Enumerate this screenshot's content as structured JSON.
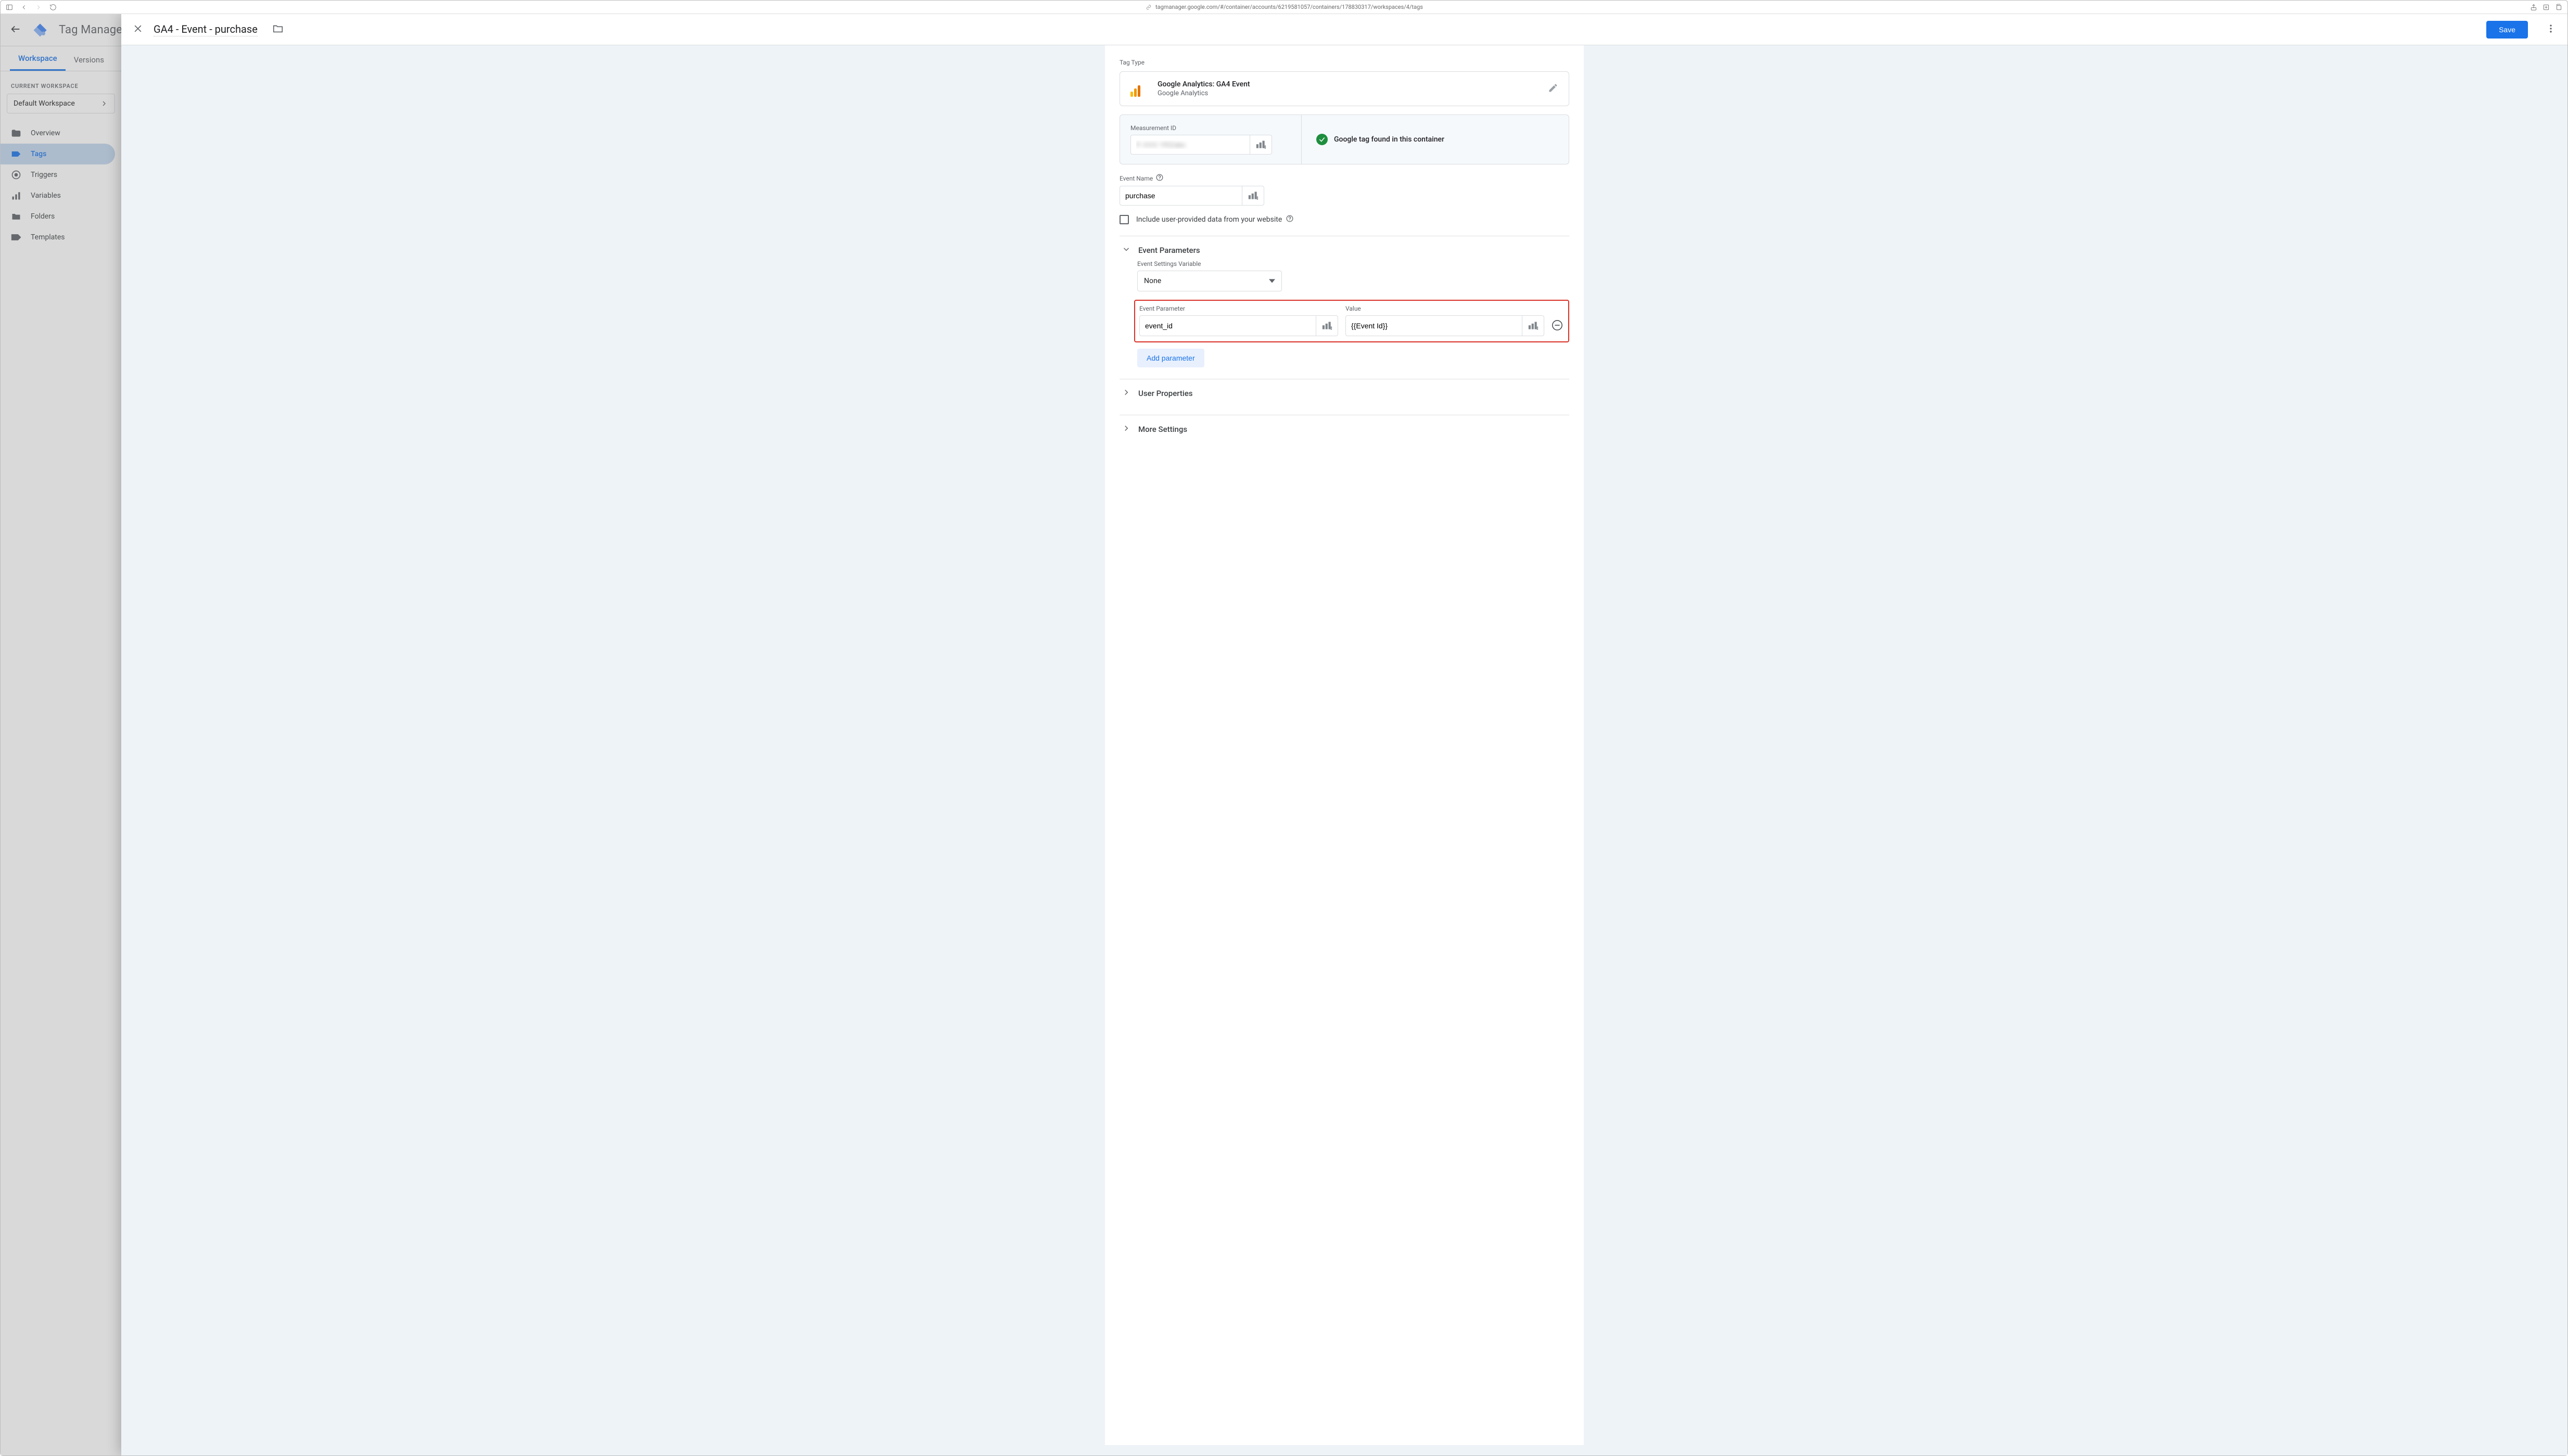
{
  "browser": {
    "url": "tagmanager.google.com/#/container/accounts/6219581057/containers/178830317/workspaces/4/tags"
  },
  "app": {
    "title": "Tag Manager",
    "tabs": {
      "workspace": "Workspace",
      "versions": "Versions"
    },
    "workspace_label": "CURRENT WORKSPACE",
    "workspace_name": "Default Workspace",
    "nav": {
      "overview": "Overview",
      "tags": "Tags",
      "triggers": "Triggers",
      "variables": "Variables",
      "folders": "Folders",
      "templates": "Templates"
    }
  },
  "panel": {
    "title": "GA4 - Event - purchase",
    "save": "Save",
    "tag_type_label": "Tag Type",
    "tag_type_title": "Google Analytics: GA4 Event",
    "tag_type_sub": "Google Analytics",
    "measurement_id_label": "Measurement ID",
    "measurement_id_value": "F-XXX YRZabc",
    "google_tag_found": "Google tag found in this container",
    "event_name_label": "Event Name",
    "event_name_value": "purchase",
    "include_user_data": "Include user-provided data from your website",
    "event_parameters_header": "Event Parameters",
    "event_settings_var_label": "Event Settings Variable",
    "event_settings_var_value": "None",
    "event_param_col": "Event Parameter",
    "value_col": "Value",
    "param_name": "event_id",
    "param_value": "{{Event Id}}",
    "add_parameter": "Add parameter",
    "user_properties_header": "User Properties",
    "more_settings_header": "More Settings"
  }
}
